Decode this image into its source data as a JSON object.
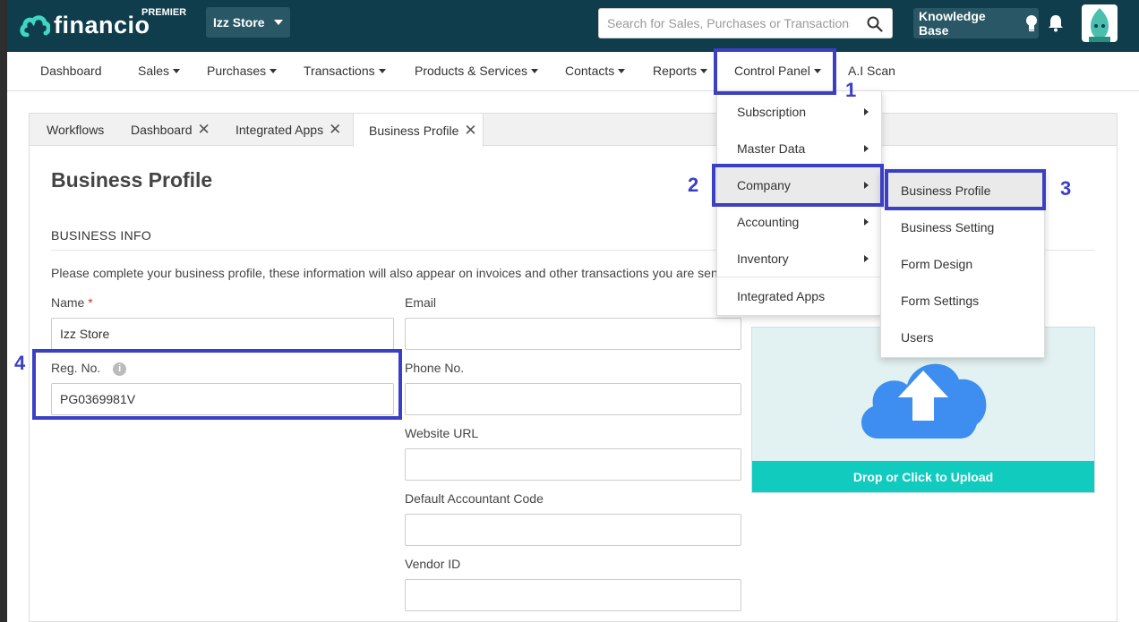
{
  "topbar": {
    "logo_text": "financio",
    "plan": "PREMIER",
    "store_name": "Izz Store",
    "search_placeholder": "Search for Sales, Purchases or Transactions",
    "knowledge_base": "Knowledge Base"
  },
  "nav": {
    "dashboard": "Dashboard",
    "sales": "Sales",
    "purchases": "Purchases",
    "transactions": "Transactions",
    "products": "Products & Services",
    "contacts": "Contacts",
    "reports": "Reports",
    "control_panel": "Control Panel",
    "ai_scan": "A.I Scan"
  },
  "tabs": {
    "workflows": "Workflows",
    "dashboard": "Dashboard",
    "integrated_apps": "Integrated Apps",
    "business_profile": "Business Profile"
  },
  "control_panel_menu": {
    "subscription": "Subscription",
    "master_data": "Master Data",
    "company": "Company",
    "accounting": "Accounting",
    "inventory": "Inventory",
    "integrated_apps": "Integrated Apps"
  },
  "company_menu": {
    "business_profile": "Business Profile",
    "business_setting": "Business Setting",
    "form_design": "Form Design",
    "form_settings": "Form Settings",
    "users": "Users"
  },
  "annotations": {
    "step1": "1",
    "step2": "2",
    "step3": "3",
    "step4": "4"
  },
  "page": {
    "title": "Business Profile",
    "section": "BUSINESS INFO",
    "description": "Please complete your business profile, these information will also appear on invoices and other transactions you are sending.",
    "name_label": "Name",
    "required_mark": "*",
    "name_value": "Izz Store",
    "reg_label": "Reg. No.",
    "reg_value": "PG0369981V",
    "email_label": "Email",
    "email_value": "",
    "phone_label": "Phone No.",
    "phone_value": "",
    "website_label": "Website URL",
    "website_value": "",
    "accountant_label": "Default Accountant Code",
    "accountant_value": "",
    "vendor_label": "Vendor ID",
    "vendor_value": "",
    "upload_label": "Drop or Click to Upload"
  },
  "colors": {
    "topbar": "#0f3d4c",
    "highlight": "#3b3fc4",
    "upload_button": "#12cbbf",
    "upload_icon": "#3d8ef0"
  }
}
